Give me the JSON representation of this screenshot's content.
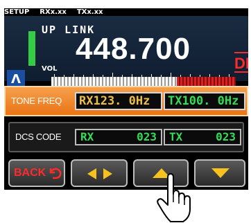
{
  "status_bar": {
    "setup": "SETUP",
    "rx": "RXx.xx",
    "tx": "TXx.xx"
  },
  "display": {
    "mode": "UP LINK",
    "frequency": "448.700",
    "vol_label": "VOL",
    "dn_badge": "DN",
    "side_symbol": "Λ"
  },
  "tone_row": {
    "label": "TONE FREQ",
    "rx_value": "RX123. 0Hz",
    "tx_value": "TX100. 0Hz"
  },
  "dcs_row": {
    "label": "DCS CODE",
    "rx_label": "RX",
    "rx_value": "023",
    "tx_label": "TX",
    "tx_value": "023"
  },
  "buttons": {
    "back_label": "BACK",
    "icons": [
      "back-arrow-icon",
      "left-right-arrows-icon",
      "up-arrow-icon",
      "down-arrow-icon"
    ]
  },
  "colors": {
    "orange": "#f08a2c",
    "green": "#33dd55",
    "yellow": "#f0c040",
    "red": "#ff2a2a"
  },
  "meter": {
    "white_fraction": 0.68
  }
}
